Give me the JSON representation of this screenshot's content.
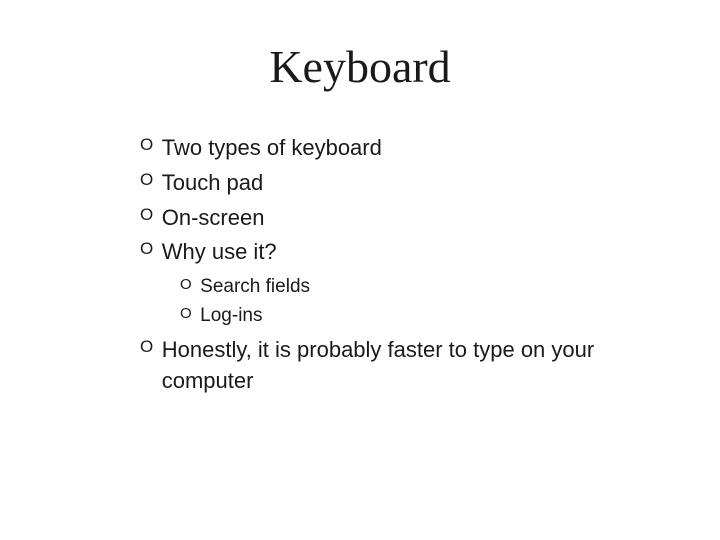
{
  "title": "Keyboard",
  "marker": "O",
  "items": {
    "i0": "Two types of keyboard",
    "i1": "Touch pad",
    "i2": "On-screen",
    "i3": "Why use it?",
    "i3_sub": {
      "s0": "Search fields",
      "s1": "Log-ins"
    },
    "i4": "Honestly, it is probably faster to type on your computer"
  }
}
